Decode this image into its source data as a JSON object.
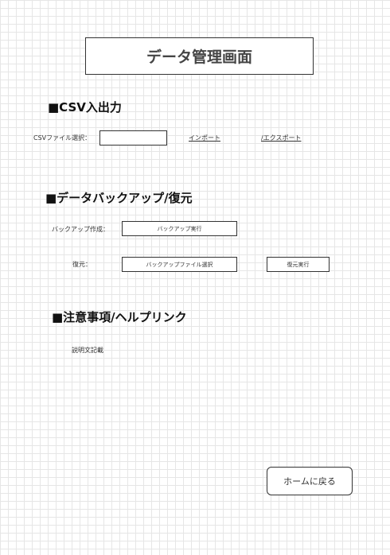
{
  "header": {
    "title": "データ管理画面"
  },
  "csv_section": {
    "heading": "■CSV入出力",
    "file_label": "CSVファイル選択：",
    "file_value": "",
    "import_link": "インポート",
    "export_link": "/エクスポート"
  },
  "backup_section": {
    "heading": "■データバックアップ/復元",
    "create_label": "バックアップ作成：",
    "run_backup_button": "バックアップ実行",
    "restore_label": "復元：",
    "select_file_button": "バックアップファイル選択",
    "run_restore_button": "復元実行"
  },
  "notes_section": {
    "heading": "■注意事項/ヘルプリンク",
    "description": "説明文記載"
  },
  "footer": {
    "home_button": "ホームに戻る"
  }
}
